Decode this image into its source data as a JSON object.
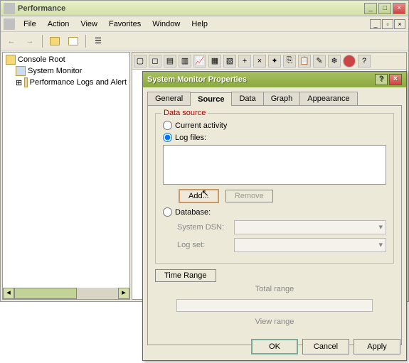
{
  "window": {
    "title": "Performance",
    "menu": [
      "File",
      "Action",
      "View",
      "Favorites",
      "Window",
      "Help"
    ]
  },
  "tree": {
    "root": "Console Root",
    "items": [
      {
        "label": "System Monitor"
      },
      {
        "label": "Performance Logs and Alert"
      }
    ]
  },
  "dialog": {
    "title": "System Monitor Properties",
    "tabs": [
      "General",
      "Source",
      "Data",
      "Graph",
      "Appearance"
    ],
    "active_tab": "Source",
    "groupbox_legend": "Data source",
    "radio_current": "Current activity",
    "radio_logfiles": "Log files:",
    "radio_database": "Database:",
    "add_btn": "Add...",
    "remove_btn": "Remove",
    "system_dsn_label": "System DSN:",
    "log_set_label": "Log set:",
    "time_range_btn": "Time Range",
    "total_range_label": "Total range",
    "view_range_label": "View range",
    "ok": "OK",
    "cancel": "Cancel",
    "apply": "Apply"
  }
}
